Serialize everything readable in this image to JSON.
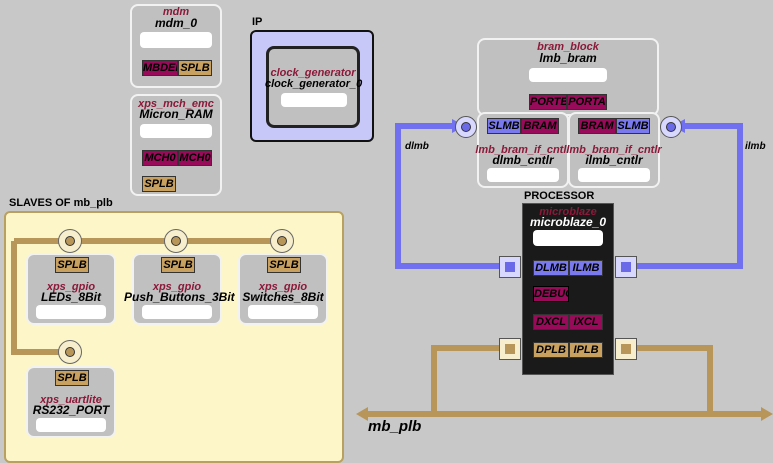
{
  "blocks": {
    "mdm": {
      "type": "mdm",
      "instance": "mdm_0",
      "ports": [
        "MBDEBUG",
        "SPLB"
      ]
    },
    "mch": {
      "type": "xps_mch_emc",
      "instance": "Micron_RAM",
      "ports": [
        "MCH0",
        "MCH0",
        "SPLB"
      ]
    },
    "clock": {
      "group": "IP",
      "type": "clock_generator",
      "instance": "clock_generator_0"
    },
    "bram": {
      "type": "bram_block",
      "instance": "lmb_bram",
      "ports": [
        "PORTB",
        "PORTA"
      ]
    },
    "dlmb_ctrl": {
      "type": "lmb_bram_if_cntlr",
      "instance": "dlmb_cntlr",
      "ports": [
        "SLMB",
        "BRAM"
      ]
    },
    "ilmb_ctrl": {
      "type": "lmb_bram_if_cntlr",
      "instance": "ilmb_cntlr",
      "ports": [
        "BRAM",
        "SLMB"
      ]
    },
    "processor": {
      "group": "PROCESSOR",
      "type": "microblaze",
      "instance": "microblaze_0",
      "ports": [
        "DLMB",
        "ILMB",
        "DEBUG",
        "DXCL",
        "IXCL",
        "DPLB",
        "IPLB"
      ]
    }
  },
  "slaves": {
    "title": "SLAVES OF mb_plb",
    "items": [
      {
        "type": "xps_gpio",
        "instance": "LEDs_8Bit",
        "port": "SPLB"
      },
      {
        "type": "xps_gpio",
        "instance": "Push_Buttons_3Bit",
        "port": "SPLB"
      },
      {
        "type": "xps_gpio",
        "instance": "Switches_8Bit",
        "port": "SPLB"
      },
      {
        "type": "xps_uartlite",
        "instance": "RS232_PORT",
        "port": "SPLB"
      }
    ]
  },
  "buses": {
    "dlmb": "dlmb",
    "ilmb": "ilmb",
    "plb": "mb_plb"
  },
  "colors": {
    "plb": "#b8965a",
    "lmb": "#7070f0",
    "magenta": "#9a0a5a",
    "splb": "#c8a060",
    "bg": "#c8c8c8",
    "slaves_bg": "#fdf6c8"
  }
}
